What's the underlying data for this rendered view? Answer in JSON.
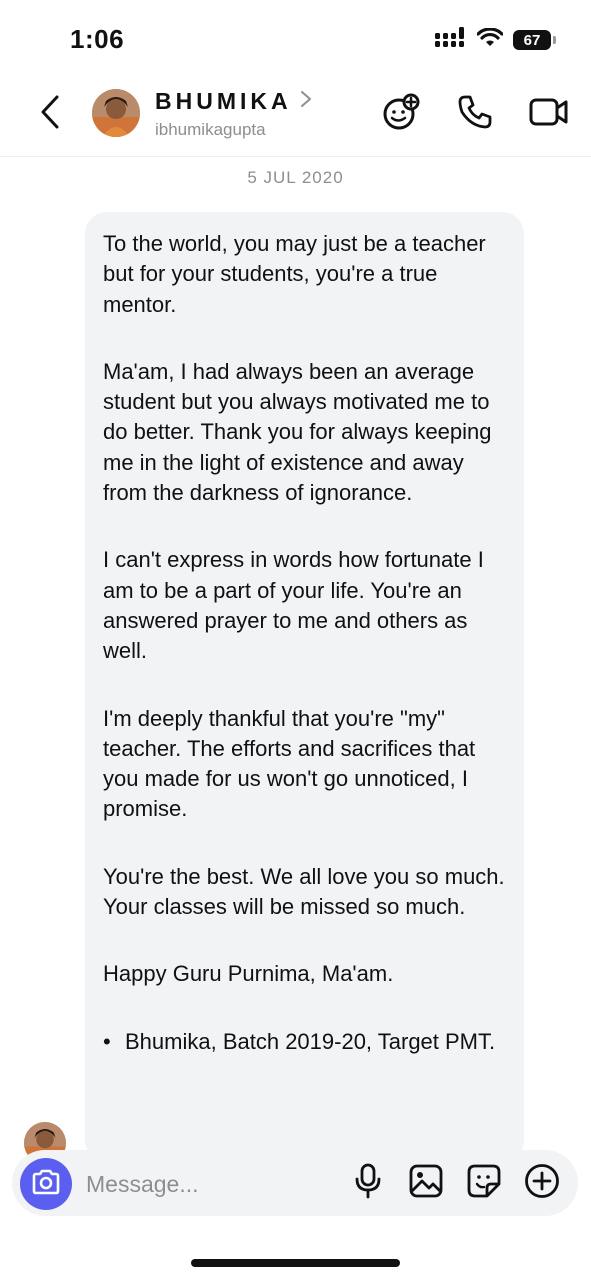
{
  "status_bar": {
    "time": "1:06",
    "battery": "67",
    "icons": [
      "cellular-signal-icon",
      "wifi-icon",
      "battery-icon"
    ]
  },
  "header": {
    "contact_name": "BHUMIKA",
    "username": "ibhumikagupta",
    "icons": [
      "back-chevron-icon",
      "chevron-right-icon",
      "effects-icon",
      "phone-icon",
      "video-camera-icon"
    ]
  },
  "conversation": {
    "date": "5 JUL 2020",
    "message": {
      "paragraphs": [
        "To the world, you may just be a teacher but for your students, you're a true mentor.",
        "Ma'am, I had always been an average student but you always motivated me to do better. Thank you for always keeping me in the light of existence and away from the darkness of ignorance.",
        "I can't express in words how fortunate I am to be a part of your life. You're an answered prayer to me and others as well.",
        "I'm deeply thankful that you're \"my\" teacher. The efforts and sacrifices that you made for us won't go unnoticed, I promise.",
        "You're the best. We all love you so much. Your classes will be missed so much.",
        "Happy Guru Purnima, Ma'am."
      ],
      "signature_bullet": "•",
      "signature": "Bhumika, Batch 2019-20, Target PMT."
    }
  },
  "composer": {
    "placeholder": "Message...",
    "icons": [
      "camera-icon",
      "microphone-icon",
      "gallery-icon",
      "sticker-icon",
      "add-icon"
    ]
  },
  "colors": {
    "camera_button": "#5b5ff0",
    "bubble_bg": "#f2f3f5",
    "muted_text": "#8e8e8e"
  }
}
